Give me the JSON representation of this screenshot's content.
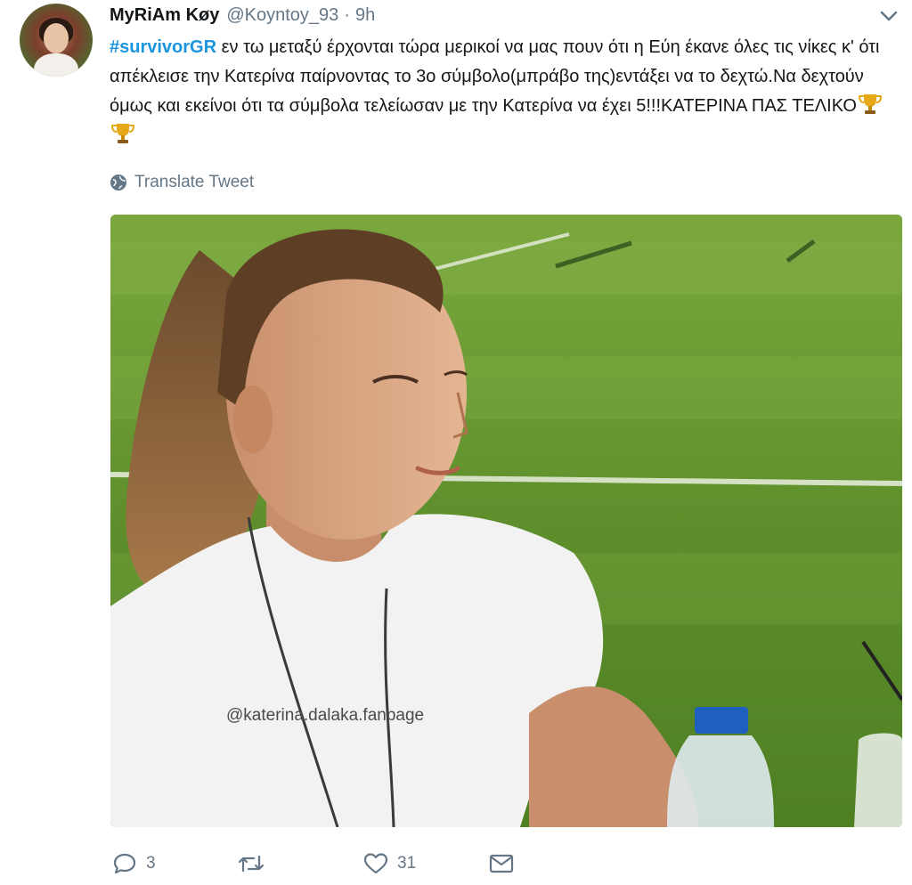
{
  "user": {
    "name": "MyRiAm Køy",
    "handle": "@Koyntoy_93",
    "separator": "·",
    "time": "9h"
  },
  "tweet": {
    "hashtag": "#survivorGR",
    "text": " εν τω μεταξύ έρχονται τώρα μερικοί να μας πουν ότι η Εύη έκανε όλες τις νίκες κ' ότι απέκλεισε την Κατερίνα παίρνοντας το 3ο σύμβολο(μπράβο της)εντάξει να το δεχτώ.Να δεχτούν όμως και εκείνοι ότι τα σύμβολα τελείωσαν με την Κατερίνα να έχει 5!!!ΚΑΤΕΡΙΝΑ ΠΑΣ ΤΕΛΙΚΟ",
    "emoji": "trophy-icon",
    "translate_label": "Translate Tweet"
  },
  "media": {
    "watermark": "@katerina.dalaka.fanpage"
  },
  "actions": {
    "reply_count": "3",
    "retweet_count": "",
    "like_count": "31"
  },
  "colors": {
    "hashtag": "#1b95e0",
    "meta": "#657786",
    "text": "#14171a"
  }
}
